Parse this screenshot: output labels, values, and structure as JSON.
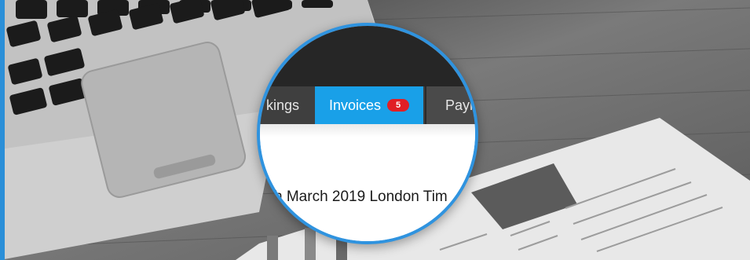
{
  "tabs": [
    {
      "label": "kings"
    },
    {
      "label": "Invoices",
      "badge": "5",
      "active": true
    },
    {
      "label": "Paym"
    }
  ],
  "date_text": "h March 2019 London Tim",
  "colors": {
    "accent": "#19a0e8",
    "badge": "#e01f25",
    "frame": "#2f93df"
  }
}
